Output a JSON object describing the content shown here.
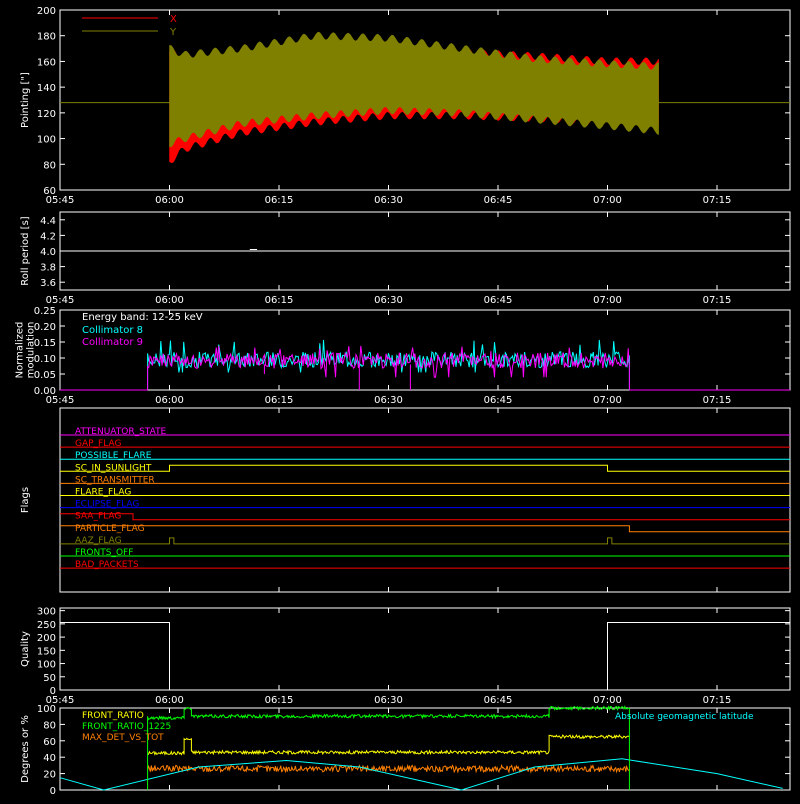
{
  "colors": {
    "background": "#000000",
    "axis": "#ffffff",
    "red": "#ff0000",
    "olive": "#808000",
    "cyan": "#00ffff",
    "magenta": "#ff00ff",
    "yellow": "#ffff00",
    "orange": "#ff8000",
    "green": "#00ff00",
    "blue": "#0000ff"
  },
  "time_axis": {
    "range_min": [
      345,
      800
    ],
    "ticks": [
      {
        "label": "05:45",
        "min": 345
      },
      {
        "label": "06:00",
        "min": 360
      },
      {
        "label": "06:15",
        "min": 375
      },
      {
        "label": "06:30",
        "min": 390
      },
      {
        "label": "06:45",
        "min": 405
      },
      {
        "label": "07:00",
        "min": 420
      },
      {
        "label": "07:15",
        "min": 435
      }
    ]
  },
  "chart_data": [
    {
      "id": "pointing",
      "type": "area",
      "ylabel": "Pointing [\"]",
      "ylim": [
        60,
        200
      ],
      "yticks": [
        60,
        80,
        100,
        120,
        140,
        160,
        180,
        200
      ],
      "legend": [
        "X",
        "Y"
      ],
      "series": [
        {
          "name": "X",
          "color": "#ff0000",
          "envelope": [
            [
              360,
              82,
              168
            ],
            [
              362,
              92,
              162
            ],
            [
              370,
              105,
              160
            ],
            [
              380,
              113,
              165
            ],
            [
              390,
              118,
              168
            ],
            [
              400,
              118,
              167
            ],
            [
              410,
              116,
              164
            ],
            [
              420,
              113,
              160
            ],
            [
              427,
              112,
              160
            ]
          ]
        },
        {
          "name": "Y",
          "color": "#808000",
          "envelope": [
            [
              360,
              96,
              170
            ],
            [
              362,
              100,
              165
            ],
            [
              370,
              112,
              170
            ],
            [
              380,
              118,
              180
            ],
            [
              390,
              122,
              178
            ],
            [
              400,
              120,
              170
            ],
            [
              410,
              115,
              162
            ],
            [
              420,
              110,
              158
            ],
            [
              427,
              106,
              156
            ]
          ]
        }
      ],
      "reference_line": 128
    },
    {
      "id": "roll_period",
      "type": "line",
      "ylabel": "Roll period [s]",
      "ylim": [
        3.5,
        4.5
      ],
      "yticks": [
        3.6,
        3.8,
        4.0,
        4.2,
        4.4
      ],
      "series": [
        {
          "name": "Roll period",
          "color": "#ffffff",
          "constant": 4.0
        }
      ]
    },
    {
      "id": "modulation",
      "type": "line",
      "ylabel": "Normalized modulation",
      "ylim": [
        0,
        0.25
      ],
      "yticks": [
        0.0,
        0.05,
        0.1,
        0.15,
        0.2,
        0.25
      ],
      "annotation": "Energy band: 12-25 keV",
      "active": [
        357,
        423
      ],
      "series": [
        {
          "name": "Collimator 8",
          "color": "#00ffff",
          "level": 0.095,
          "range": [
            0.055,
            0.16
          ]
        },
        {
          "name": "Collimator 9",
          "color": "#ff00ff",
          "level": 0.092,
          "range": [
            0.04,
            0.14
          ]
        }
      ]
    },
    {
      "id": "flags",
      "type": "line",
      "ylabel": "Flags",
      "flags": [
        {
          "name": "ATTENUATOR_STATE",
          "color": "#ff00ff",
          "steps": []
        },
        {
          "name": "GAP_FLAG",
          "color": "#ff0000",
          "steps": [
            [
              357,
              -1
            ],
            [
              423,
              1
            ]
          ]
        },
        {
          "name": "POSSIBLE_FLARE",
          "color": "#00ffff",
          "steps": []
        },
        {
          "name": "SC_IN_SUNLIGHT",
          "color": "#ffff00",
          "steps": [
            [
              360,
              1
            ],
            [
              420,
              -1
            ]
          ]
        },
        {
          "name": "SC_TRANSMITTER",
          "color": "#ff8000",
          "steps": []
        },
        {
          "name": "FLARE_FLAG",
          "color": "#ffff00",
          "steps": []
        },
        {
          "name": "ECLIPSE_FLAG",
          "color": "#0000ff",
          "steps": [
            [
              360,
              -1
            ],
            [
              420,
              1
            ]
          ]
        },
        {
          "name": "SAA_FLAG",
          "color": "#ff0000",
          "steps": [
            [
              355,
              -1
            ]
          ]
        },
        {
          "name": "PARTICLE_FLAG",
          "color": "#ff8000",
          "steps": [
            [
              423,
              -1
            ]
          ]
        },
        {
          "name": "AAZ_FLAG",
          "color": "#808000",
          "steps": [
            [
              360,
              1
            ],
            [
              360.6,
              -1
            ],
            [
              420,
              1
            ],
            [
              420.6,
              -1
            ]
          ]
        },
        {
          "name": "FRONTS_OFF",
          "color": "#00ff00",
          "steps": []
        },
        {
          "name": "BAD_PACKETS",
          "color": "#ff0000",
          "steps": []
        }
      ]
    },
    {
      "id": "quality",
      "type": "line",
      "ylabel": "Quality",
      "ylim": [
        0,
        310
      ],
      "yticks": [
        0,
        50,
        100,
        150,
        200,
        250,
        300
      ],
      "series": [
        {
          "name": "Quality",
          "color": "#ffffff",
          "points": [
            [
              345,
              255
            ],
            [
              360,
              255
            ],
            [
              360,
              0
            ],
            [
              420,
              0
            ],
            [
              420,
              255
            ],
            [
              445,
              255
            ]
          ]
        }
      ]
    },
    {
      "id": "ratios",
      "type": "line",
      "ylabel": "Degrees or %",
      "ylim": [
        0,
        100
      ],
      "yticks": [
        0,
        20,
        40,
        60,
        80,
        100
      ],
      "annotation": "Absolute geomagnetic latitude",
      "series": [
        {
          "name": "FRONT_RATIO",
          "color": "#ffff00",
          "segments": [
            [
              357,
              362,
              45
            ],
            [
              362,
              363,
              62
            ],
            [
              363,
              412,
              46
            ],
            [
              412,
              423,
              65
            ]
          ]
        },
        {
          "name": "FRONT_RATIO_1225",
          "color": "#00ff00",
          "segments": [
            [
              357,
              362,
              88
            ],
            [
              362,
              363,
              100
            ],
            [
              363,
              412,
              90
            ],
            [
              412,
              423,
              100
            ]
          ]
        },
        {
          "name": "MAX_DET_VS_TOT",
          "color": "#ff8000",
          "segments": [
            [
              357,
              423,
              26
            ]
          ]
        },
        {
          "name": "Absolute geomagnetic latitude",
          "color": "#00ffff",
          "points": [
            [
              345,
              15
            ],
            [
              351,
              0
            ],
            [
              364,
              28
            ],
            [
              376,
              36
            ],
            [
              386,
              28
            ],
            [
              396,
              8
            ],
            [
              400,
              0
            ],
            [
              410,
              28
            ],
            [
              422,
              38
            ],
            [
              435,
              20
            ],
            [
              444,
              2
            ]
          ]
        }
      ]
    }
  ]
}
